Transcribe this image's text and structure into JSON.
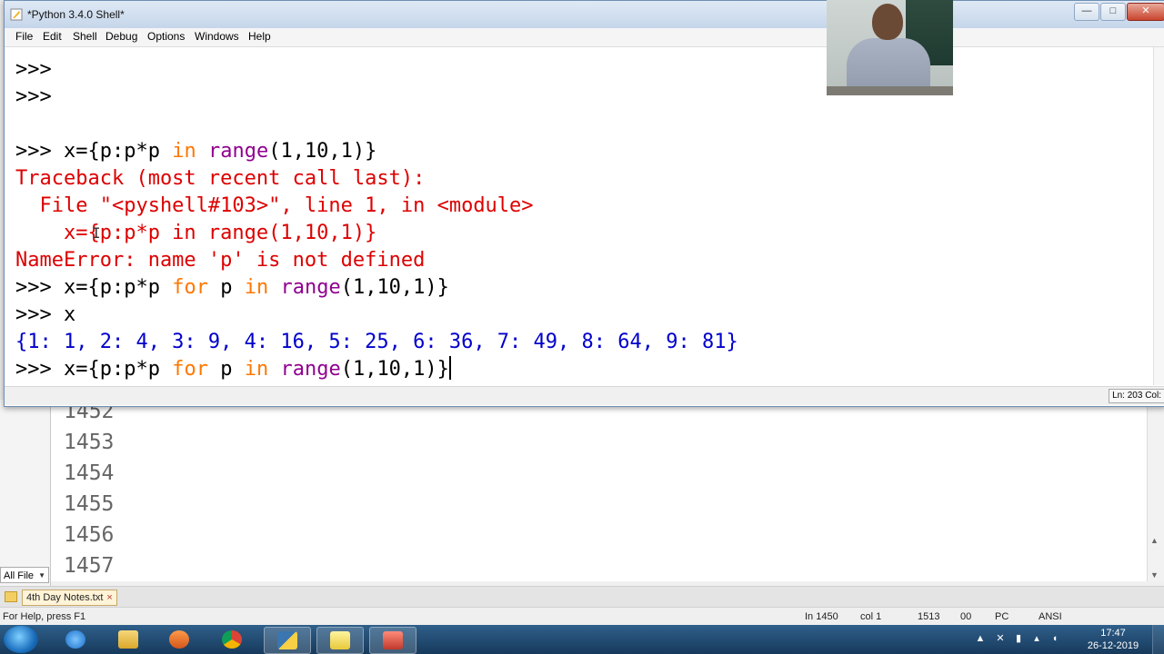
{
  "idle_window": {
    "title": "*Python 3.4.0 Shell*",
    "menus": [
      "File",
      "Edit",
      "Shell",
      "Debug",
      "Options",
      "Windows",
      "Help"
    ],
    "status_line": "Ln: 203 Col:"
  },
  "shell": {
    "prompt": ">>>",
    "line3_cmd": "x={p:p*p ",
    "kw_in": "in",
    "kw_for": "for",
    "builtin_range": "range",
    "range_args": "(1,10,1)}",
    "traceback_head": "Traceback (most recent call last):",
    "traceback_file": "  File \"<pyshell#103>\", line 1, in <module>",
    "traceback_code": "    x={p:p*p in range(1,10,1)}",
    "name_error": "NameError: name 'p' is not defined",
    "cmd_prefix": "x={p:p*p ",
    "var_p": " p ",
    "cmd_x": "x",
    "result": "{1: 1, 2: 4, 3: 9, 4: 16, 5: 25, 6: 36, 7: 49, 8: 64, 9: 81}",
    "current_range_args": "(1,10,1)}"
  },
  "background_editor": {
    "line_numbers": [
      "1452",
      "1453",
      "1454",
      "1455",
      "1456",
      "1457"
    ],
    "filter_label": "All File",
    "tab_label": "4th Day Notes.txt",
    "status_help": "For Help, press F1",
    "status_ln": "In 1450",
    "status_col": "col 1",
    "status_count": "1513",
    "status_00": "00",
    "status_pc": "PC",
    "status_encoding": "ANSI"
  },
  "taskbar": {
    "time": "17:47",
    "date": "26-12-2019"
  },
  "colors": {
    "prompt": "#000000",
    "keyword": "#ff7700",
    "builtin": "#900090",
    "error": "#dd0000",
    "output": "#0000cc"
  }
}
